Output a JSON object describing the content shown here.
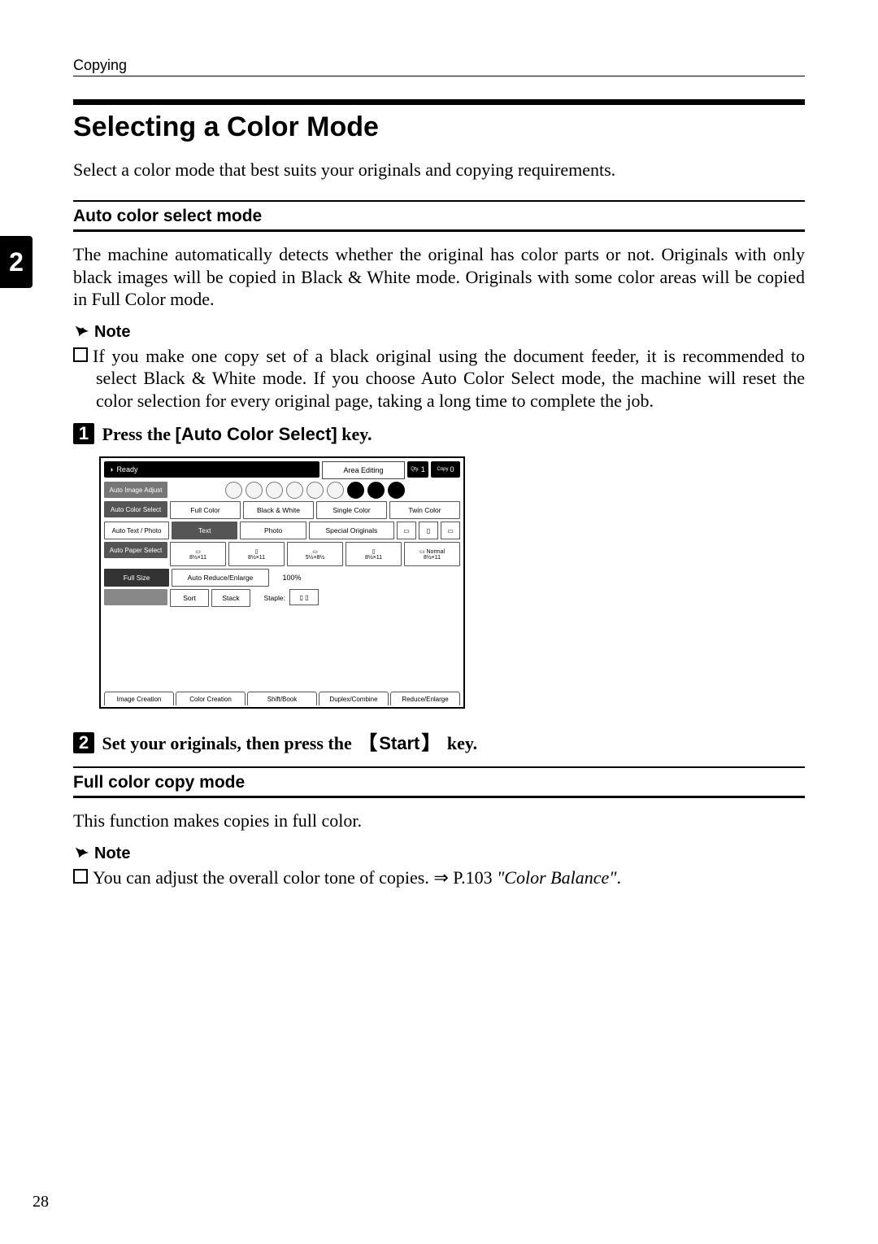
{
  "running_head": "Copying",
  "chapter_tab": "2",
  "page_number": "28",
  "h1": "Selecting a Color Mode",
  "intro": "Select a color mode that best suits your originals and copying requirements.",
  "section_auto": {
    "title": "Auto color select mode",
    "body": "The machine automatically detects whether the original has color parts or not. Originals with only black images will be copied in Black & White mode. Originals with some color areas will be copied in Full Color mode.",
    "note_label": "Note",
    "note_item": "If you make one copy set of a black original using the document feeder, it is recommended to select Black & White mode. If you choose Auto Color Select mode, the machine will reset the color selection for every original page, taking a long time to complete the job."
  },
  "step1": {
    "lead": "Press the ",
    "key": "[Auto Color Select]",
    "tail": " key."
  },
  "step2": {
    "lead": "Set your originals, then press the ",
    "key": "Start",
    "tail": " key."
  },
  "section_full": {
    "title": "Full color copy mode",
    "body": "This function makes copies in full color.",
    "note_label": "Note",
    "note_item_pre": "You can adjust the overall color tone of copies. ⇒ P.103 ",
    "note_item_ref": "\"Color Balance\"",
    "note_item_post": "."
  },
  "panel": {
    "status": "Ready",
    "area_editing": "Area Editing",
    "qty_label": "Qty.",
    "qty_value": "1",
    "copy_label": "Copy",
    "copy_value": "0",
    "density_label": "Auto Image Adjust",
    "density_dots": 9,
    "density_dark_start": 6,
    "color_row_label": "Auto Color Select",
    "color_modes": [
      "Full Color",
      "Black & White",
      "Single Color",
      "Twin Color"
    ],
    "orig_row_label": "Auto Text / Photo",
    "orig_types": [
      "Text",
      "Photo",
      "Special Originals"
    ],
    "paper_row_label": "Auto Paper Select",
    "trays": [
      "8½×11",
      "8½×11",
      "5½×8½",
      "8½×11",
      "8½×11"
    ],
    "tray_last_label": "Normal",
    "size_btn": "Full Size",
    "reduce_btn": "Auto Reduce/Enlarge",
    "ratio": "100%",
    "finish_row_label": "",
    "sort": "Sort",
    "stack": "Stack",
    "staple_label": "Staple:",
    "bottom_tabs": [
      "Image Creation",
      "Color Creation",
      "Shift/Book",
      "Duplex/Combine",
      "Reduce/Enlarge"
    ]
  }
}
